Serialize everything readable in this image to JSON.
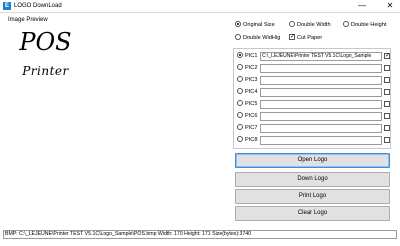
{
  "window": {
    "title": "LOGO DownLoad",
    "icon_letter": "E",
    "minimize_glyph": "—",
    "close_glyph": "✕",
    "icon_color": "#1c7fd1"
  },
  "preview": {
    "label": "Image Preview",
    "logo_line1": "POS",
    "logo_line2": "Printer"
  },
  "size_options": [
    {
      "label": "Original Size",
      "selected": true
    },
    {
      "label": "Double Width",
      "selected": false
    },
    {
      "label": "Double Height",
      "selected": false
    },
    {
      "label": "Double WidHig",
      "selected": false
    }
  ],
  "cut_paper": {
    "label": "Cut Paper",
    "checked": true
  },
  "pics": [
    {
      "label": "PIC1",
      "path": "C:\\_LEJEUNE\\Printer TEST V5.1C\\Logo_Sample",
      "selected": true,
      "checked": true
    },
    {
      "label": "PIC2",
      "path": "",
      "selected": false,
      "checked": false
    },
    {
      "label": "PIC3",
      "path": "",
      "selected": false,
      "checked": false
    },
    {
      "label": "PIC4",
      "path": "",
      "selected": false,
      "checked": false
    },
    {
      "label": "PIC5",
      "path": "",
      "selected": false,
      "checked": false
    },
    {
      "label": "PIC6",
      "path": "",
      "selected": false,
      "checked": false
    },
    {
      "label": "PIC7",
      "path": "",
      "selected": false,
      "checked": false
    },
    {
      "label": "PIC8",
      "path": "",
      "selected": false,
      "checked": false
    }
  ],
  "buttons": {
    "open_logo": "Open Logo",
    "down_logo": "Down Logo",
    "print_logo": "Print Logo",
    "clear_logo": "Clear Logo"
  },
  "status_text": "BMP: C:\\_LEJEUNE\\Printer TEST V5.1C\\Logo_Sample\\POS.bmp  Width: 170  Height: 171  Size(bytes):3740"
}
